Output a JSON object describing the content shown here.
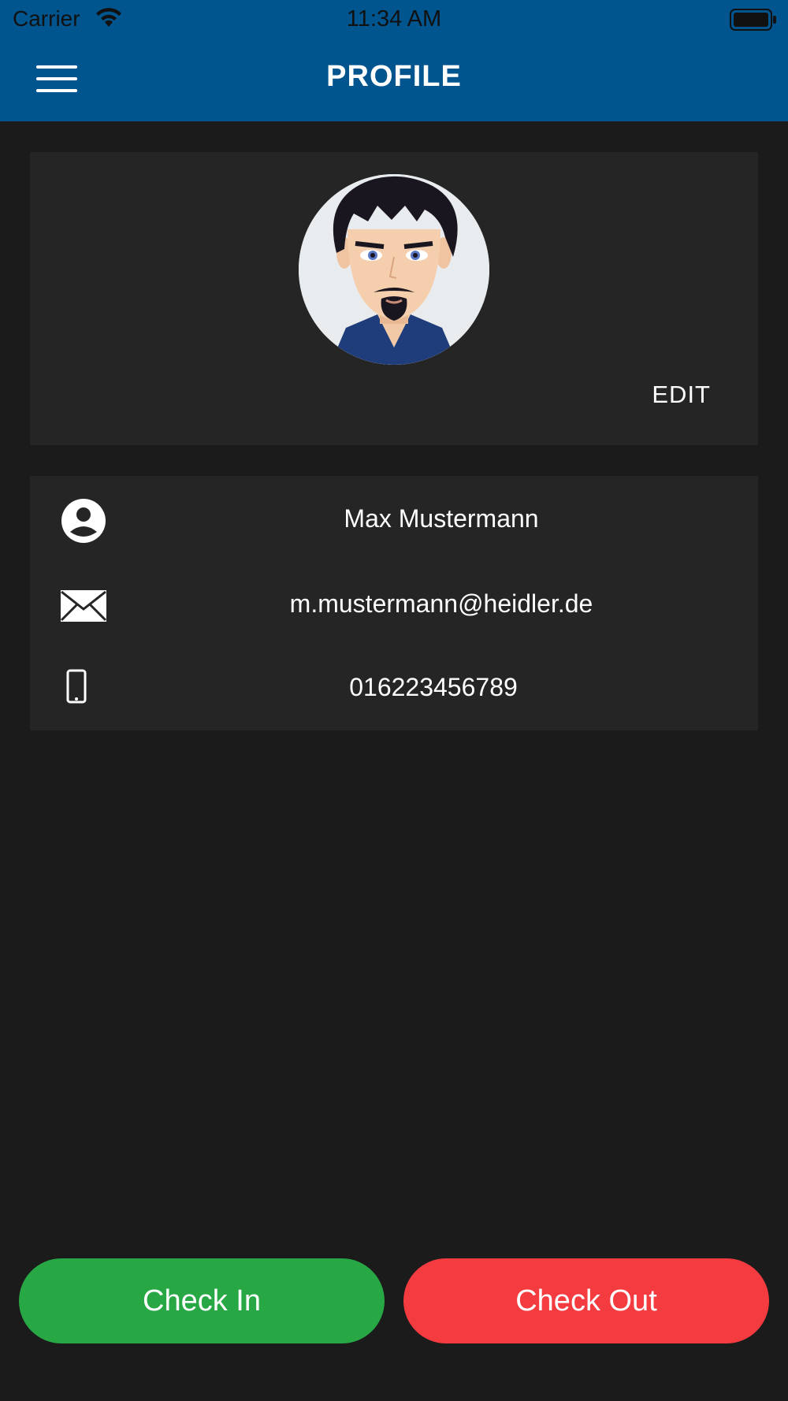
{
  "status_bar": {
    "carrier": "Carrier",
    "time": "11:34 AM"
  },
  "nav": {
    "title": "PROFILE"
  },
  "profile": {
    "edit_label": "EDIT",
    "name": "Max Mustermann",
    "email": "m.mustermann@heidler.de",
    "phone": "016223456789"
  },
  "actions": {
    "check_in": "Check In",
    "check_out": "Check Out"
  },
  "colors": {
    "nav_bg": "#00558e",
    "page_bg": "#1b1b1b",
    "card_bg": "#252525",
    "check_in": "#28a745",
    "check_out": "#f43b3f"
  },
  "icons": {
    "menu": "hamburger-menu-icon",
    "name": "person-circle-icon",
    "email": "envelope-icon",
    "phone": "mobile-phone-icon"
  }
}
